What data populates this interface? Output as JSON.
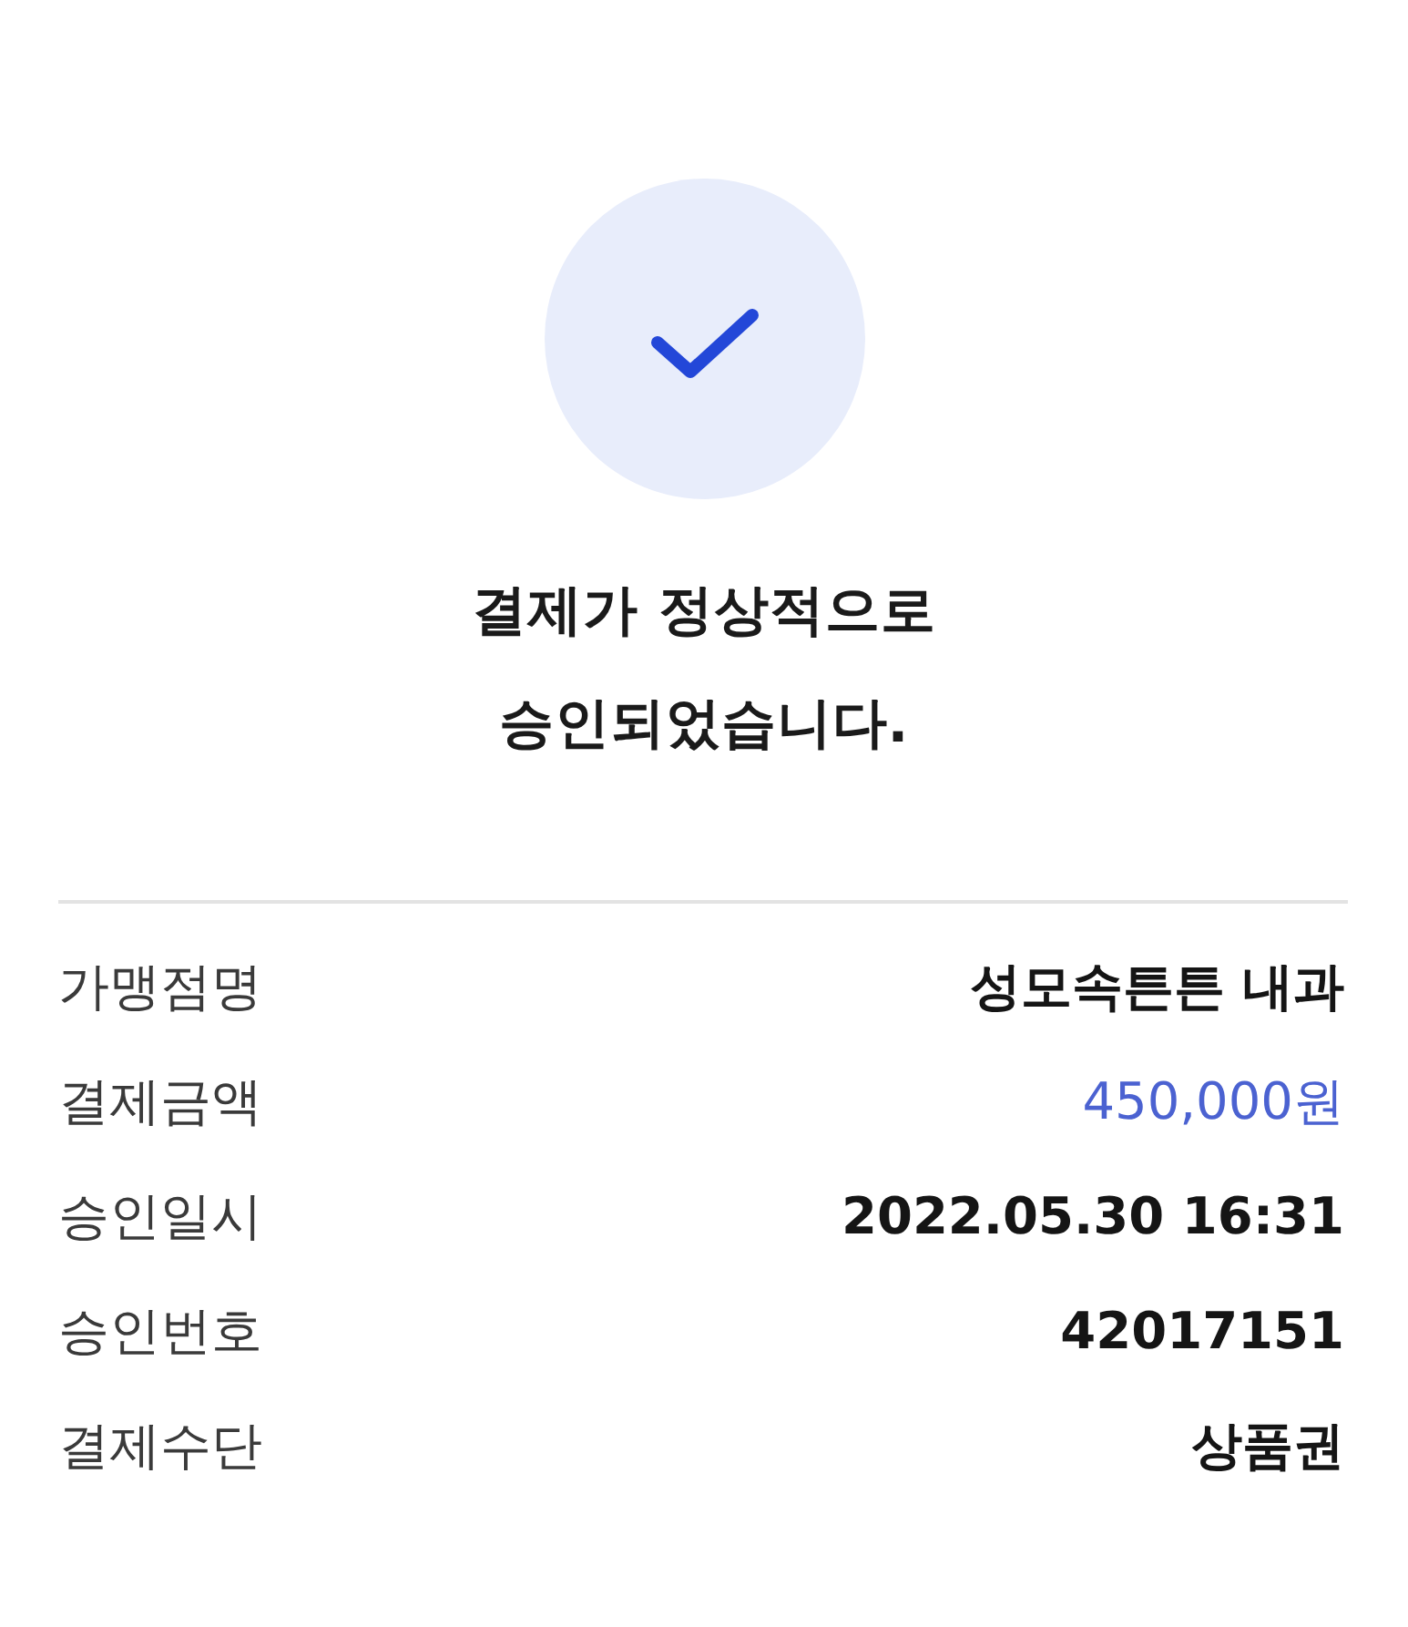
{
  "status": {
    "title_lines": [
      "결제가 정상적으로",
      "승인되었습니다."
    ]
  },
  "details": [
    {
      "kind": "text",
      "label": "가맹점명",
      "value": "성모속튼튼 내과"
    },
    {
      "kind": "amount",
      "label": "결제금액",
      "value": "450,000원"
    },
    {
      "kind": "text",
      "label": "승인일시",
      "value": "2022.05.30 16:31"
    },
    {
      "kind": "text",
      "label": "승인번호",
      "value": "42017151"
    },
    {
      "kind": "text",
      "label": "결제수단",
      "value": "상품권"
    }
  ]
}
